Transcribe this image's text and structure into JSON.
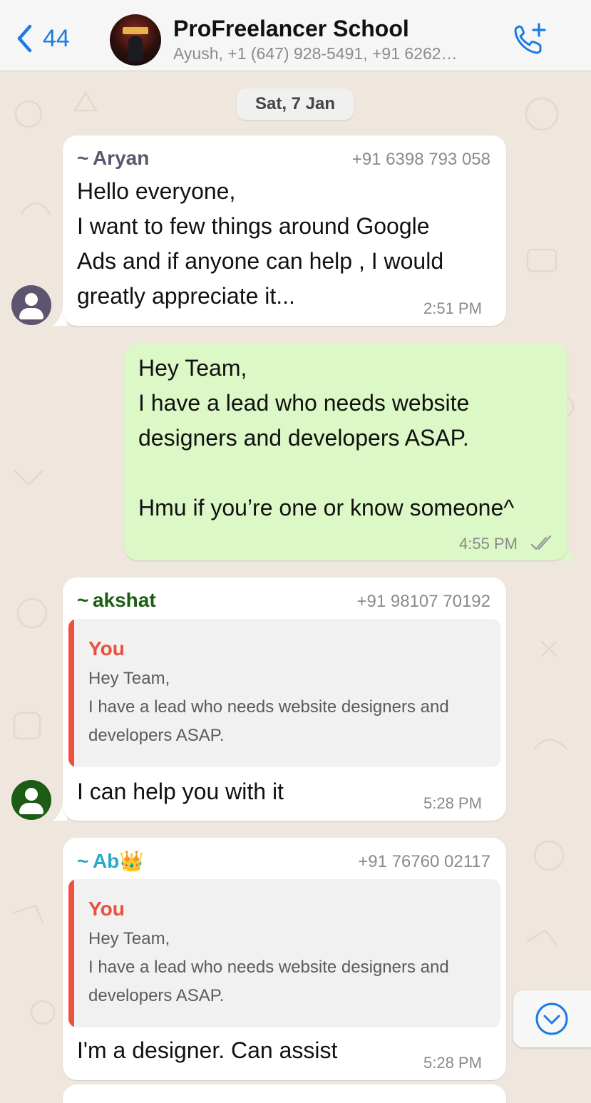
{
  "header": {
    "back_count": "44",
    "title": "ProFreelancer School",
    "subtitle": "Ayush, +1 (647) 928-5491, +91 6262…"
  },
  "date_separator": "Sat, 7 Jan",
  "messages": [
    {
      "sender": "~ Aryan",
      "sender_color": "#5d5570",
      "phone": "+91 6398 793 058",
      "text": "Hello everyone,\nI want to few things around Google\nAds and if anyone can help , I would\ngreatly appreciate it...",
      "time": "2:51 PM"
    },
    {
      "text": "Hey Team,\nI have a lead who needs website\ndesigners and developers ASAP.\n\nHmu if you’re one or know someone^",
      "time": "4:55 PM",
      "status": "read-double-check"
    },
    {
      "sender": "~ akshat",
      "sender_color": "#1d5c14",
      "phone": "+91 98107 70192",
      "quote_name": "You",
      "quote_text": "Hey Team,\nI have a lead who needs website designers and\ndevelopers ASAP.",
      "text": "I can help you with it",
      "time": "5:28 PM"
    },
    {
      "sender": "~ Ab👑",
      "sender_color": "#28a9c9",
      "phone": "+91 76760 02117",
      "quote_name": "You",
      "quote_text": "Hey Team,\nI have a lead who needs website designers and\ndevelopers ASAP.",
      "text": "I'm a designer. Can assist",
      "time": "5:28 PM"
    }
  ],
  "colors": {
    "accent": "#1a7be0",
    "outgoing_bubble": "#dcf8c6",
    "quote_bar": "#f0513c"
  },
  "icons": [
    "back-chevron-icon",
    "add-call-icon",
    "double-check-icon",
    "scroll-down-icon",
    "default-avatar-icon"
  ]
}
